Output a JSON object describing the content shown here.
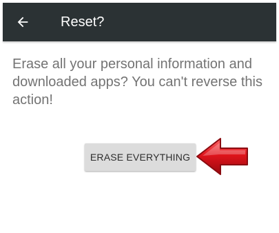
{
  "toolbar": {
    "back_icon": "arrow-left-icon",
    "title": "Reset?",
    "background_color": "#2b3234"
  },
  "content": {
    "message": "Erase all your personal information and downloaded apps? You can't reverse this action!"
  },
  "action": {
    "erase_label": "ERASE EVERYTHING"
  },
  "annotation": {
    "icon": "pointing-arrow-icon",
    "color": "#e0141c"
  }
}
